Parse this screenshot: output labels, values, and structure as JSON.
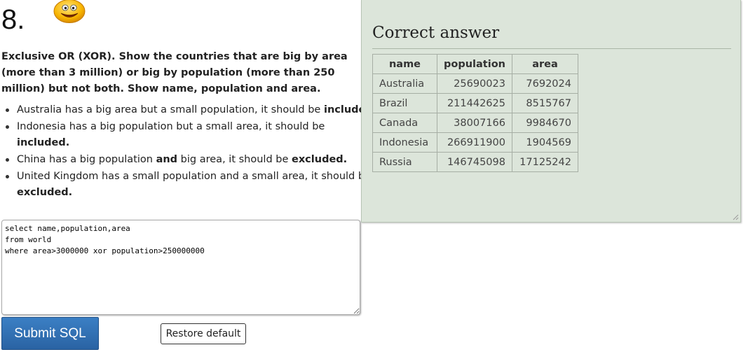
{
  "question": {
    "number": "8.",
    "smiley_icon": "smiley-face-icon",
    "text": "Exclusive OR (XOR). Show the countries that are big by area (more than 3 million) or big by population (more than 250 million) but not both. Show name, population and area.",
    "hints": [
      {
        "before": "Australia has a big area but a small population, it should be ",
        "mid_bold": "",
        "middle": "",
        "end_bold": "included."
      },
      {
        "before": "Indonesia has a big population but a small area, it should be ",
        "mid_bold": "",
        "middle": "",
        "end_bold": "included."
      },
      {
        "before": "China has a big population ",
        "mid_bold": "and",
        "middle": " big area, it should be ",
        "end_bold": "excluded."
      },
      {
        "before": "United Kingdom has a small population and a small area, it should be ",
        "mid_bold": "",
        "middle": "",
        "end_bold": "excluded."
      }
    ]
  },
  "editor": {
    "sql": "select name,population,area\nfrom world\nwhere area>3000000 xor population>250000000"
  },
  "buttons": {
    "submit_label": "Submit SQL",
    "restore_label": "Restore default"
  },
  "answer": {
    "title": "Correct answer",
    "columns": [
      "name",
      "population",
      "area"
    ],
    "rows": [
      [
        "Australia",
        "25690023",
        "7692024"
      ],
      [
        "Brazil",
        "211442625",
        "8515767"
      ],
      [
        "Canada",
        "38007166",
        "9984670"
      ],
      [
        "Indonesia",
        "266911900",
        "1904569"
      ],
      [
        "Russia",
        "146745098",
        "17125242"
      ]
    ]
  }
}
